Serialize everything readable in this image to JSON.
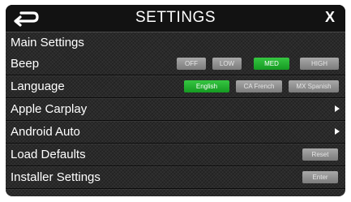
{
  "header": {
    "title": "SETTINGS",
    "close_label": "X",
    "back_icon": "back-arrow-icon"
  },
  "section": {
    "title": "Main Settings"
  },
  "beep": {
    "label": "Beep",
    "options": [
      "OFF",
      "LOW",
      "MED",
      "HIGH"
    ],
    "selected": "MED"
  },
  "language": {
    "label": "Language",
    "options": [
      "English",
      "CA French",
      "MX Spanish"
    ],
    "selected": "English"
  },
  "carplay": {
    "label": "Apple Carplay",
    "icon": "chevron-right-icon"
  },
  "android": {
    "label": "Android Auto",
    "icon": "chevron-right-icon"
  },
  "defaults": {
    "label": "Load Defaults",
    "button": "Reset"
  },
  "installer": {
    "label": "Installer Settings",
    "button": "Enter"
  },
  "colors": {
    "active": "#22b32f",
    "inactive": "#8f8f8f",
    "header": "#121212",
    "background": "#2a2a2a"
  }
}
